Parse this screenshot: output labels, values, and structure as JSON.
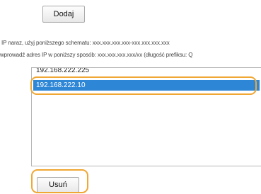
{
  "buttons": {
    "add_label": "Dodaj",
    "remove_label": "Usuń"
  },
  "instructions": {
    "line1": "IP naraz, użyj poniższego schematu: xxx.xxx.xxx.xxx-xxx.xxx.xxx.xxx",
    "line2": "wprowadź adres IP w poniższy sposób: xxx.xxx.xxx.xxx/xx (długość prefiksu: Q"
  },
  "ip_list": {
    "items": [
      "192.168.222.225",
      "192.168.222.10"
    ],
    "selected_index": 1
  },
  "colors": {
    "highlight": "#f0a733",
    "selection": "#2e86d6"
  }
}
